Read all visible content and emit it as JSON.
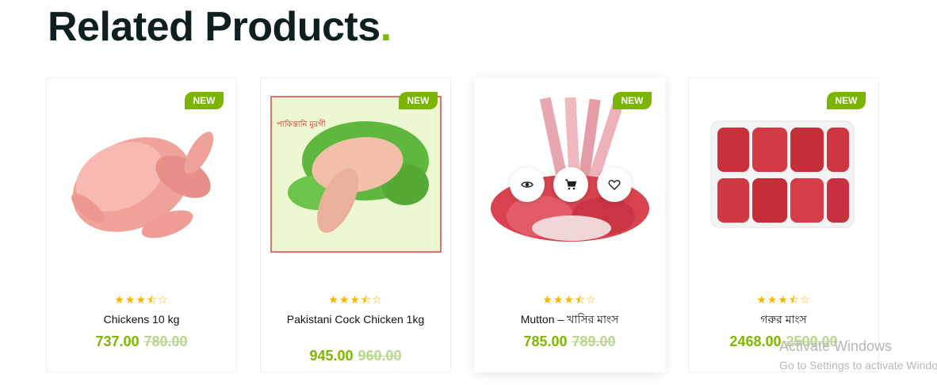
{
  "section": {
    "title": "Related Products",
    "dot": "."
  },
  "products": [
    {
      "name": "Chickens 10 kg",
      "badge": "NEW",
      "rating_stars": "★★★⯪☆",
      "rating_value": 3.5,
      "price": "737.00",
      "old_price": "780.00",
      "image_text": ""
    },
    {
      "name": "Pakistani Cock Chicken 1kg",
      "badge": "NEW",
      "rating_stars": "★★★⯪☆",
      "rating_value": 3.5,
      "price": "945.00",
      "old_price": "960.00",
      "image_text": "পাকিস্তানি মুরগী"
    },
    {
      "name": "Mutton – খাসির মাংস",
      "badge": "NEW",
      "rating_stars": "★★★⯪☆",
      "rating_value": 3.5,
      "price": "785.00",
      "old_price": "789.00",
      "image_text": ""
    },
    {
      "name": "গরুর মাংস",
      "badge": "NEW",
      "rating_stars": "★★★⯪☆",
      "rating_value": 3.5,
      "price": "2468.00",
      "old_price": "2500.00",
      "image_text": ""
    }
  ],
  "actions": {
    "icons": [
      "eye-icon",
      "cart-icon",
      "heart-icon"
    ]
  },
  "watermark": {
    "title": "Activate Windows",
    "subtitle": "Go to Settings to activate Windows."
  },
  "colors": {
    "accent": "#80b500",
    "badge": "#7bb500",
    "star": "#f7b500",
    "old_price": "#b9d78a"
  }
}
